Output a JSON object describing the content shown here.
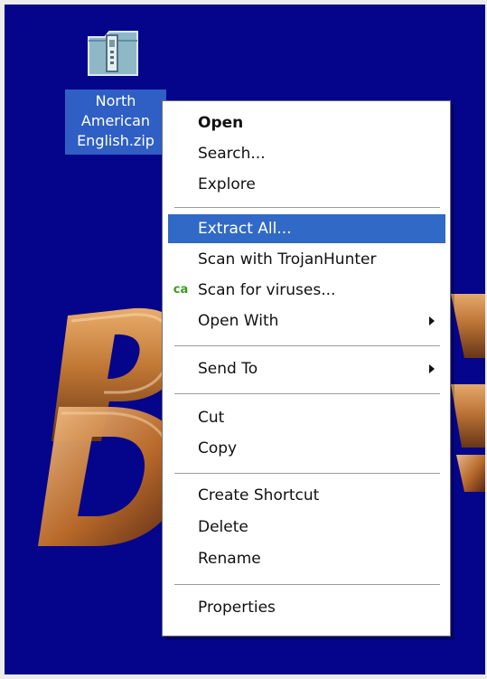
{
  "screen": {
    "background_color": "#04058a",
    "frame_color": "#ececec"
  },
  "desktop": {
    "item": {
      "icon": "zip-folder-icon",
      "label": "North\nAmerican\nEnglish.zip",
      "selected": true
    },
    "wallpaper_icon": "wallpaper-logo-icon"
  },
  "context_menu": {
    "items": [
      {
        "label": "Open",
        "bold": true
      },
      {
        "label": "Search..."
      },
      {
        "label": "Explore"
      },
      {
        "label": "Extract All...",
        "highlighted": true
      },
      {
        "label": "Scan with TrojanHunter"
      },
      {
        "label": "Scan for viruses...",
        "icon": "ca-antivirus-icon",
        "icon_text": "ca"
      },
      {
        "label": "Open With",
        "submenu": true
      },
      {
        "label": "Send To",
        "submenu": true
      },
      {
        "label": "Cut"
      },
      {
        "label": "Copy"
      },
      {
        "label": "Create Shortcut"
      },
      {
        "label": "Delete"
      },
      {
        "label": "Rename"
      },
      {
        "label": "Properties"
      }
    ]
  }
}
